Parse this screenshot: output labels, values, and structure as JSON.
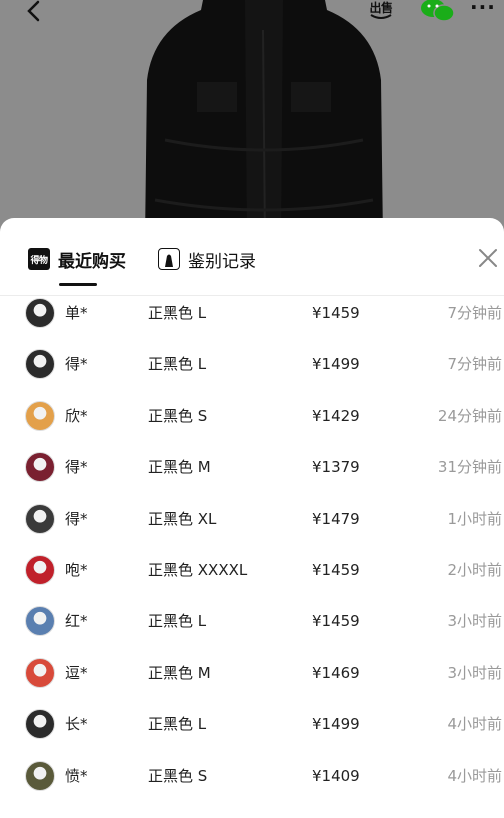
{
  "header": {
    "back_icon": "chevron-left-icon",
    "sell_label": "出售",
    "wechat_icon": "wechat-icon",
    "more_label": "···"
  },
  "sheet": {
    "tabs": [
      {
        "label": "最近购买",
        "icon_text": "得物",
        "icon": "dewu-logo-icon",
        "active": true
      },
      {
        "label": "鉴别记录",
        "icon": "shopping-bag-icon",
        "active": false
      }
    ],
    "close_icon": "close-icon"
  },
  "records": [
    {
      "name": "单*",
      "sku": "正黑色 L",
      "price": "¥1459",
      "time": "7分钟前",
      "avatar_color": "#2b2b2b"
    },
    {
      "name": "得*",
      "sku": "正黑色 L",
      "price": "¥1499",
      "time": "7分钟前",
      "avatar_color": "#2b2b2b"
    },
    {
      "name": "欣*",
      "sku": "正黑色 S",
      "price": "¥1429",
      "time": "24分钟前",
      "avatar_color": "#e3a04a"
    },
    {
      "name": "得*",
      "sku": "正黑色 M",
      "price": "¥1379",
      "time": "31分钟前",
      "avatar_color": "#7a2030"
    },
    {
      "name": "得*",
      "sku": "正黑色 XL",
      "price": "¥1479",
      "time": "1小时前",
      "avatar_color": "#3a3a3a"
    },
    {
      "name": "咆*",
      "sku": "正黑色 XXXXL",
      "price": "¥1459",
      "time": "2小时前",
      "avatar_color": "#c0202a"
    },
    {
      "name": "红*",
      "sku": "正黑色 L",
      "price": "¥1459",
      "time": "3小时前",
      "avatar_color": "#5a7fb0"
    },
    {
      "name": "逗*",
      "sku": "正黑色 M",
      "price": "¥1469",
      "time": "3小时前",
      "avatar_color": "#d84a3a"
    },
    {
      "name": "长*",
      "sku": "正黑色 L",
      "price": "¥1499",
      "time": "4小时前",
      "avatar_color": "#2b2b2b"
    },
    {
      "name": "愤*",
      "sku": "正黑色 S",
      "price": "¥1409",
      "time": "4小时前",
      "avatar_color": "#5a5a3a"
    }
  ]
}
